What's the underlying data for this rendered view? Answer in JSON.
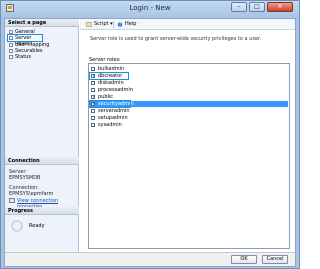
{
  "window": {
    "title": "Login - New",
    "minimize_glyph": "–",
    "maximize_glyph": "□",
    "close_glyph": "✕"
  },
  "left_pane": {
    "select_page_header": "Select a page",
    "pages": [
      {
        "label": "General",
        "icon": "page-icon"
      },
      {
        "label": "Server Roles",
        "icon": "page-icon",
        "highlighted": true
      },
      {
        "label": "User Mapping",
        "icon": "page-icon"
      },
      {
        "label": "Securables",
        "icon": "page-icon"
      },
      {
        "label": "Status",
        "icon": "page-icon"
      }
    ],
    "connection_header": "Connection",
    "server_label": "Server:",
    "server_value": "EPMSYSMDB",
    "connection_label": "Connection:",
    "connection_value": "EPMSYS\\epmfarm",
    "view_connection_link": "View connection properties",
    "progress_header": "Progress",
    "progress_status": "Ready"
  },
  "toolbar": {
    "script_label": "Script",
    "help_label": "Help",
    "dropdown_glyph": "▾"
  },
  "content": {
    "description": "Server role is used to grant server-wide security privileges to a user.",
    "roles_label": "Server roles:",
    "roles": [
      {
        "name": "bulkadmin",
        "checked": false
      },
      {
        "name": "dbcreator",
        "checked": true,
        "highlighted": true
      },
      {
        "name": "diskadmin",
        "checked": false
      },
      {
        "name": "processadmin",
        "checked": false
      },
      {
        "name": "public",
        "checked": true
      },
      {
        "name": "securityadmin",
        "checked": true,
        "selected": true,
        "highlighted": true
      },
      {
        "name": "serveradmin",
        "checked": false
      },
      {
        "name": "setupadmin",
        "checked": false
      },
      {
        "name": "sysadmin",
        "checked": false
      }
    ],
    "check_glyph": "✓"
  },
  "buttons": {
    "ok_label": "OK",
    "cancel_label": "Cancel"
  },
  "colors": {
    "selection": "#3399ff",
    "highlight_outline": "#1f8fd6",
    "link": "#1a4fa8"
  }
}
